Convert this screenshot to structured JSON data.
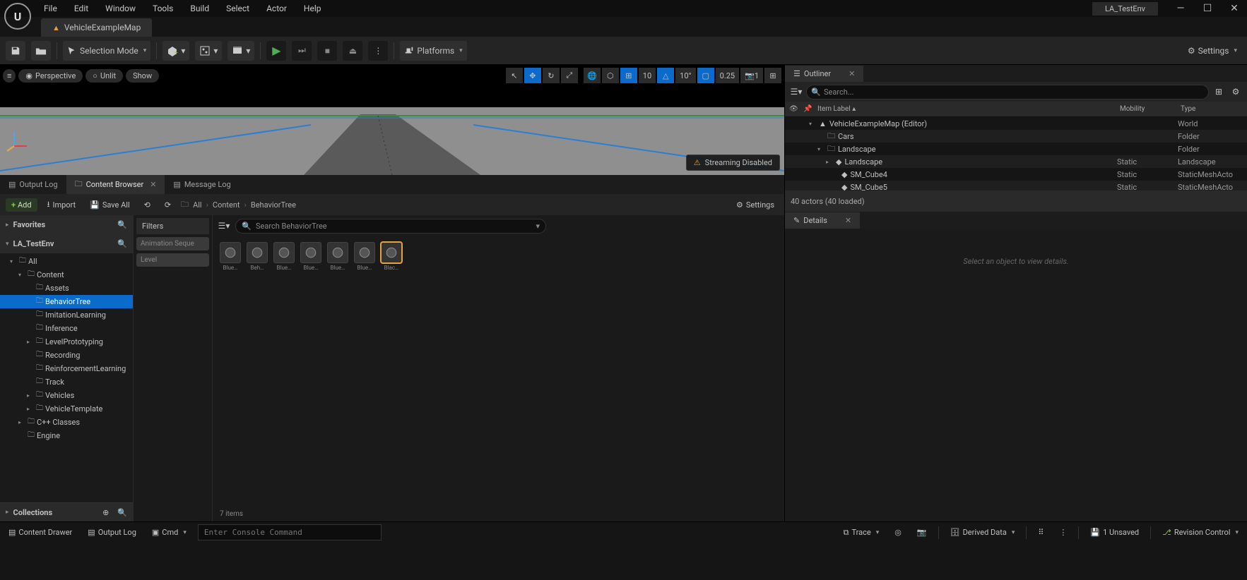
{
  "titlebar": {
    "menus": [
      "File",
      "Edit",
      "Window",
      "Tools",
      "Build",
      "Select",
      "Actor",
      "Help"
    ],
    "project": "LA_TestEnv"
  },
  "tabs": {
    "map_tab": "VehicleExampleMap"
  },
  "toolbar": {
    "selection_mode": "Selection Mode",
    "platforms": "Platforms",
    "settings": "Settings"
  },
  "viewport": {
    "hamburger": "≡",
    "perspective": "Perspective",
    "lit": "Unlit",
    "show": "Show",
    "grid_snap": "10",
    "angle_snap": "10°",
    "scale_snap": "0.25",
    "camera_speed": "1",
    "streaming": "Streaming Disabled"
  },
  "panels": {
    "output_log": "Output Log",
    "content_browser": "Content Browser",
    "message_log": "Message Log"
  },
  "content_browser": {
    "add": "Add",
    "import": "Import",
    "save_all": "Save All",
    "path_root": "All",
    "path_parts": [
      "Content",
      "BehaviorTree"
    ],
    "settings": "Settings",
    "favorites": "Favorites",
    "project": "LA_TestEnv",
    "collections": "Collections",
    "filters_label": "Filters",
    "filter_chips": [
      "Animation Seque",
      "Level"
    ],
    "search_placeholder": "Search BehaviorTree",
    "tree": [
      {
        "depth": 1,
        "label": "All",
        "expand": "▾"
      },
      {
        "depth": 2,
        "label": "Content",
        "expand": "▾"
      },
      {
        "depth": 3,
        "label": "Assets",
        "expand": ""
      },
      {
        "depth": 3,
        "label": "BehaviorTree",
        "expand": "",
        "sel": true
      },
      {
        "depth": 3,
        "label": "ImitationLearning",
        "expand": ""
      },
      {
        "depth": 3,
        "label": "Inference",
        "expand": ""
      },
      {
        "depth": 3,
        "label": "LevelPrototyping",
        "expand": "▸"
      },
      {
        "depth": 3,
        "label": "Recording",
        "expand": ""
      },
      {
        "depth": 3,
        "label": "ReinforcementLearning",
        "expand": ""
      },
      {
        "depth": 3,
        "label": "Track",
        "expand": ""
      },
      {
        "depth": 3,
        "label": "Vehicles",
        "expand": "▸"
      },
      {
        "depth": 3,
        "label": "VehicleTemplate",
        "expand": "▸"
      },
      {
        "depth": 2,
        "label": "C++ Classes",
        "expand": "▸"
      },
      {
        "depth": 2,
        "label": "Engine",
        "expand": ""
      }
    ],
    "assets": [
      {
        "label": "Blue…",
        "sel": false
      },
      {
        "label": "Beh…",
        "sel": false
      },
      {
        "label": "Blue…",
        "sel": false
      },
      {
        "label": "Blue…",
        "sel": false
      },
      {
        "label": "Blue…",
        "sel": false
      },
      {
        "label": "Blue…",
        "sel": false
      },
      {
        "label": "Blac…",
        "sel": true
      }
    ],
    "item_count": "7 items"
  },
  "outliner": {
    "title": "Outliner",
    "search_placeholder": "Search...",
    "col_label": "Item Label",
    "col_mobility": "Mobility",
    "col_type": "Type",
    "rows": [
      {
        "depth": 1,
        "label": "VehicleExampleMap (Editor)",
        "mobility": "",
        "type": "World",
        "chev": "▾"
      },
      {
        "depth": 2,
        "label": "Cars",
        "mobility": "",
        "type": "Folder",
        "chev": ""
      },
      {
        "depth": 2,
        "label": "Landscape",
        "mobility": "",
        "type": "Folder",
        "chev": "▾"
      },
      {
        "depth": 3,
        "label": "Landscape",
        "mobility": "Static",
        "type": "Landscape",
        "chev": "▸"
      },
      {
        "depth": 4,
        "label": "SM_Cube4",
        "mobility": "Static",
        "type": "StaticMeshActo",
        "chev": ""
      },
      {
        "depth": 4,
        "label": "SM_Cube5",
        "mobility": "Static",
        "type": "StaticMeshActo",
        "chev": ""
      }
    ],
    "status": "40 actors (40 loaded)"
  },
  "details": {
    "title": "Details",
    "hint": "Select an object to view details."
  },
  "statusbar": {
    "content_drawer": "Content Drawer",
    "output_log": "Output Log",
    "cmd": "Cmd",
    "console_placeholder": "Enter Console Command",
    "trace": "Trace",
    "derived_data": "Derived Data",
    "unsaved": "1 Unsaved",
    "revision": "Revision Control"
  }
}
